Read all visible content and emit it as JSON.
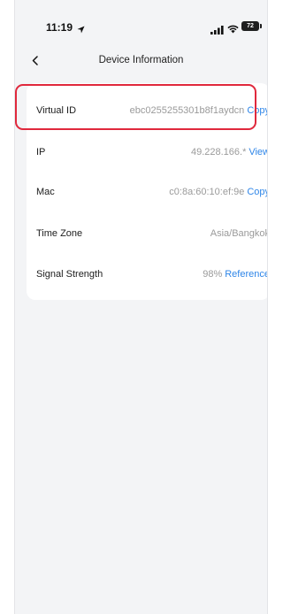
{
  "status_bar": {
    "time": "11:19",
    "battery": "72",
    "icons": [
      "location-arrow-icon",
      "signal-bars-icon",
      "wifi-icon",
      "battery-icon"
    ]
  },
  "header": {
    "back_icon": "chevron-left-icon",
    "title": "Device Information"
  },
  "rows": [
    {
      "label": "Virtual ID",
      "value": "ebc0255255301b8f1aydcn",
      "action": "Copy"
    },
    {
      "label": "IP",
      "value": "49.228.166.*",
      "action": "View"
    },
    {
      "label": "Mac",
      "value": "c0:8a:60:10:ef:9e",
      "action": "Copy"
    },
    {
      "label": "Time Zone",
      "value": "Asia/Bangkok",
      "action": ""
    },
    {
      "label": "Signal Strength",
      "value": "98%",
      "action": "Reference"
    }
  ],
  "colors": {
    "accent": "#2f86e8",
    "highlight": "#e0283c",
    "background": "#f3f4f6",
    "card": "#ffffff"
  }
}
